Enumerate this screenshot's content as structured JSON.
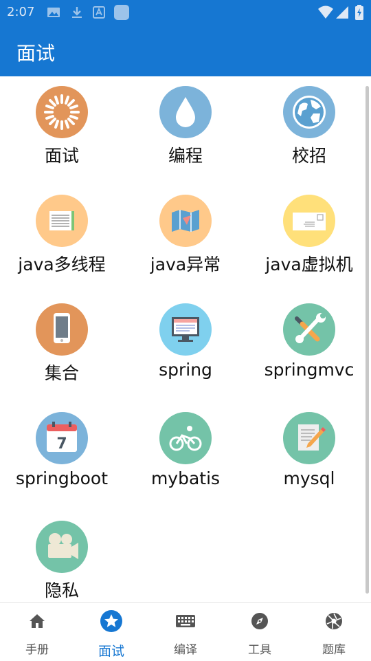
{
  "status": {
    "time": "2:07"
  },
  "app": {
    "title": "面试"
  },
  "items": [
    {
      "label": "面试",
      "icon": "sunburst-icon",
      "color": "#E2955A"
    },
    {
      "label": "编程",
      "icon": "water-drop-icon",
      "color": "#7CB3DA"
    },
    {
      "label": "校招",
      "icon": "globe-icon",
      "color": "#7CB3DA"
    },
    {
      "label": "java多线程",
      "icon": "notepad-icon",
      "color": "#FFC98A"
    },
    {
      "label": "java异常",
      "icon": "map-icon",
      "color": "#FFC98A"
    },
    {
      "label": "java虚拟机",
      "icon": "envelope-icon",
      "color": "#FFE07A"
    },
    {
      "label": "集合",
      "icon": "phone-icon",
      "color": "#E2955A"
    },
    {
      "label": "spring",
      "icon": "monitor-icon",
      "color": "#7FD0EE"
    },
    {
      "label": "springmvc",
      "icon": "wrench-screwdriver-icon",
      "color": "#74C3A8"
    },
    {
      "label": "springboot",
      "icon": "calendar-icon",
      "color": "#7CB3DA"
    },
    {
      "label": "mybatis",
      "icon": "cyclist-icon",
      "color": "#74C3A8"
    },
    {
      "label": "mysql",
      "icon": "note-pencil-icon",
      "color": "#74C3A8"
    },
    {
      "label": "隐私",
      "icon": "video-camera-icon",
      "color": "#74C3A8"
    }
  ],
  "calendar_day": "7",
  "nav": [
    {
      "label": "手册",
      "icon": "home-icon",
      "active": false
    },
    {
      "label": "面试",
      "icon": "star-icon",
      "active": true
    },
    {
      "label": "编译",
      "icon": "keyboard-icon",
      "active": false
    },
    {
      "label": "工具",
      "icon": "compass-icon",
      "active": false
    },
    {
      "label": "题库",
      "icon": "aperture-icon",
      "active": false
    }
  ],
  "colors": {
    "primary": "#1677D2",
    "nav_inactive": "#555555"
  }
}
